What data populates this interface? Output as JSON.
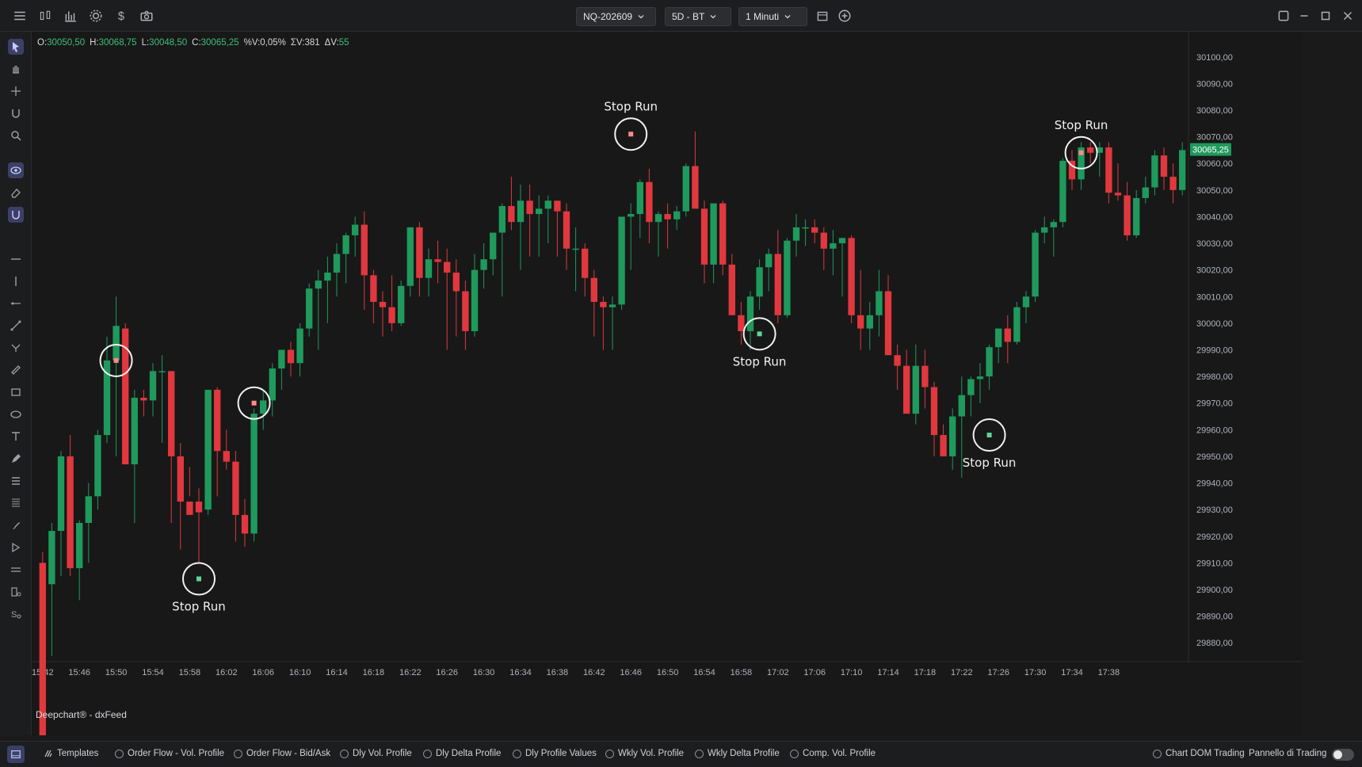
{
  "toolbar": {
    "symbol": "NQ-202609",
    "range": "5D - BT",
    "timeframe": "1 Minuti"
  },
  "ohlc": {
    "o_label": "O:",
    "o_value": "30050,50",
    "h_label": "H:",
    "h_value": "30068,75",
    "l_label": "L:",
    "l_value": "30048,50",
    "c_label": "C:",
    "c_value": "30065,25",
    "pct_label": "%V:",
    "pct_value": "0,05%",
    "sv_label": "ΣV:",
    "sv_value": "381",
    "dv_label": "ΔV:",
    "dv_value": "55"
  },
  "brand": "Deepchart® - dxFeed",
  "colors": {
    "up": "#1f9a5c",
    "down": "#e0383e",
    "background": "#181818",
    "price_tag": "#1f9a5c"
  },
  "chart_data": {
    "type": "candlestick",
    "last_price_label": "30065,25",
    "last_price": 30065.25,
    "ylim": [
      29875,
      30105
    ],
    "y_ticks": [
      "30100,00",
      "30090,00",
      "30080,00",
      "30070,00",
      "30060,00",
      "30050,00",
      "30040,00",
      "30030,00",
      "30020,00",
      "30010,00",
      "30000,00",
      "29990,00",
      "29980,00",
      "29970,00",
      "29960,00",
      "29950,00",
      "29940,00",
      "29930,00",
      "29920,00",
      "29910,00",
      "29900,00",
      "29890,00",
      "29880,00"
    ],
    "x_ticks": [
      "15:42",
      "15:46",
      "15:50",
      "15:54",
      "15:58",
      "16:02",
      "16:06",
      "16:10",
      "16:14",
      "16:18",
      "16:22",
      "16:26",
      "16:30",
      "16:34",
      "16:38",
      "16:42",
      "16:46",
      "16:50",
      "16:54",
      "16:58",
      "17:02",
      "17:06",
      "17:10",
      "17:14",
      "17:18",
      "17:22",
      "17:26",
      "17:30",
      "17:34",
      "17:38"
    ],
    "candles": [
      [
        29910,
        29914,
        29838,
        29842
      ],
      [
        29902,
        29925,
        29875,
        29922
      ],
      [
        29922,
        29952,
        29905,
        29950
      ],
      [
        29950,
        29958,
        29905,
        29908
      ],
      [
        29908,
        29926,
        29896,
        29925
      ],
      [
        29925,
        29940,
        29910,
        29935
      ],
      [
        29935,
        29960,
        29930,
        29958
      ],
      [
        29958,
        29995,
        29955,
        29986
      ],
      [
        29986,
        30010,
        29950,
        29999
      ],
      [
        29998,
        30000,
        29970,
        29947
      ],
      [
        29947,
        29975,
        29925,
        29972
      ],
      [
        29972,
        29975,
        29965,
        29971
      ],
      [
        29971,
        29985,
        29965,
        29982
      ],
      [
        29982,
        29988,
        29955,
        29982
      ],
      [
        29982,
        29982,
        29925,
        29950
      ],
      [
        29950,
        29955,
        29915,
        29933
      ],
      [
        29933,
        29946,
        29935,
        29928
      ],
      [
        29933,
        29938,
        29910,
        29929
      ],
      [
        29930,
        29975,
        29928,
        29975
      ],
      [
        29975,
        29976,
        29935,
        29952
      ],
      [
        29952,
        29960,
        29945,
        29948
      ],
      [
        29948,
        29952,
        29918,
        29928
      ],
      [
        29928,
        29934,
        29916,
        29921
      ],
      [
        29921,
        29968,
        29918,
        29966
      ],
      [
        29966,
        29975,
        29960,
        29971
      ],
      [
        29971,
        29985,
        29965,
        29983
      ],
      [
        29983,
        29990,
        29975,
        29990
      ],
      [
        29990,
        29993,
        29980,
        29985
      ],
      [
        29985,
        30000,
        29980,
        29998
      ],
      [
        29998,
        30015,
        29995,
        30013
      ],
      [
        30013,
        30020,
        29990,
        30016
      ],
      [
        30016,
        30025,
        30000,
        30019
      ],
      [
        30019,
        30030,
        30010,
        30026
      ],
      [
        30026,
        30034,
        30015,
        30033
      ],
      [
        30033,
        30040,
        30025,
        30037
      ],
      [
        30037,
        30042,
        30005,
        30018
      ],
      [
        30018,
        30020,
        30000,
        30008
      ],
      [
        30008,
        30012,
        29995,
        30006
      ],
      [
        30006,
        30018,
        29997,
        30000
      ],
      [
        30000,
        30016,
        29999,
        30014
      ],
      [
        30014,
        30036,
        30010,
        30036
      ],
      [
        30036,
        30038,
        30010,
        30017
      ],
      [
        30017,
        30028,
        30010,
        30024
      ],
      [
        30024,
        30031,
        30015,
        30023
      ],
      [
        30023,
        30028,
        29990,
        30019
      ],
      [
        30019,
        30024,
        29995,
        30012
      ],
      [
        30012,
        30016,
        29990,
        29997
      ],
      [
        29997,
        30026,
        29995,
        30020
      ],
      [
        30020,
        30030,
        30013,
        30024
      ],
      [
        30024,
        30032,
        30018,
        30034
      ],
      [
        30034,
        30045,
        30010,
        30044
      ],
      [
        30044,
        30055,
        30035,
        30038
      ],
      [
        30038,
        30052,
        30020,
        30046
      ],
      [
        30046,
        30052,
        30025,
        30041
      ],
      [
        30041,
        30048,
        30025,
        30043
      ],
      [
        30043,
        30048,
        30030,
        30046
      ],
      [
        30046,
        30046,
        30025,
        30042
      ],
      [
        30042,
        30045,
        30020,
        30028
      ],
      [
        30028,
        30036,
        30012,
        30028
      ],
      [
        30028,
        30030,
        30010,
        30017
      ],
      [
        30017,
        30020,
        29995,
        30008
      ],
      [
        30008,
        30010,
        29990,
        30006
      ],
      [
        30006,
        30010,
        29990,
        30007
      ],
      [
        30007,
        30040,
        30005,
        30040
      ],
      [
        30040,
        30045,
        30020,
        30041
      ],
      [
        30041,
        30054,
        30032,
        30053
      ],
      [
        30053,
        30058,
        30030,
        30038
      ],
      [
        30038,
        30042,
        30025,
        30041
      ],
      [
        30041,
        30045,
        30028,
        30039
      ],
      [
        30039,
        30044,
        30035,
        30042
      ],
      [
        30042,
        30060,
        30040,
        30059
      ],
      [
        30059,
        30072,
        30050,
        30043
      ],
      [
        30043,
        30046,
        30015,
        30022
      ],
      [
        30022,
        30045,
        30015,
        30045
      ],
      [
        30045,
        30046,
        30018,
        30022
      ],
      [
        30022,
        30026,
        30005,
        30003
      ],
      [
        30003,
        30008,
        29992,
        29997
      ],
      [
        29997,
        30012,
        29990,
        30010
      ],
      [
        30010,
        30024,
        30005,
        30021
      ],
      [
        30021,
        30028,
        30012,
        30026
      ],
      [
        30026,
        30035,
        30000,
        30003
      ],
      [
        30003,
        30032,
        30002,
        30031
      ],
      [
        30031,
        30041,
        30025,
        30036
      ],
      [
        30036,
        30039,
        30029,
        30036
      ],
      [
        30036,
        30039,
        30030,
        30034
      ],
      [
        30034,
        30036,
        30020,
        30028
      ],
      [
        30028,
        30035,
        30018,
        30030
      ],
      [
        30030,
        30032,
        30010,
        30032
      ],
      [
        30032,
        30033,
        30000,
        30003
      ],
      [
        30003,
        30020,
        29990,
        29998
      ],
      [
        29998,
        30008,
        29990,
        30003
      ],
      [
        30003,
        30020,
        29995,
        30012
      ],
      [
        30012,
        30018,
        29990,
        29988
      ],
      [
        29988,
        29992,
        29975,
        29984
      ],
      [
        29984,
        29990,
        29968,
        29966
      ],
      [
        29966,
        29992,
        29962,
        29984
      ],
      [
        29984,
        29990,
        29968,
        29976
      ],
      [
        29976,
        29978,
        29950,
        29958
      ],
      [
        29958,
        29962,
        29950,
        29950
      ],
      [
        29950,
        29968,
        29945,
        29965
      ],
      [
        29965,
        29980,
        29942,
        29973
      ],
      [
        29973,
        29980,
        29965,
        29979
      ],
      [
        29979,
        29985,
        29970,
        29980
      ],
      [
        29980,
        29992,
        29975,
        29991
      ],
      [
        29991,
        29998,
        29985,
        29998
      ],
      [
        29998,
        30003,
        29985,
        29993
      ],
      [
        29993,
        30008,
        29992,
        30006
      ],
      [
        30006,
        30012,
        30000,
        30010
      ],
      [
        30010,
        30035,
        30008,
        30034
      ],
      [
        30034,
        30040,
        30030,
        30036
      ],
      [
        30036,
        30039,
        30025,
        30038
      ],
      [
        30038,
        30062,
        30036,
        30061
      ],
      [
        30061,
        30065,
        30050,
        30054
      ],
      [
        30054,
        30068,
        30050,
        30066
      ],
      [
        30066,
        30068,
        30060,
        30064
      ],
      [
        30064,
        30068,
        30055,
        30066
      ],
      [
        30066,
        30068,
        30045,
        30049
      ],
      [
        30049,
        30060,
        30046,
        30048
      ],
      [
        30048,
        30053,
        30031,
        30033
      ],
      [
        30033,
        30050,
        30032,
        30047
      ],
      [
        30047,
        30055,
        30045,
        30051
      ],
      [
        30051,
        30065,
        30048,
        30063
      ],
      [
        30063,
        30066,
        30050,
        30055
      ],
      [
        30055,
        30060,
        30045,
        30050
      ],
      [
        30050,
        30068,
        30048,
        30065
      ]
    ],
    "annotations": [
      {
        "label": "Stop Run",
        "candle": 8,
        "price": 29986,
        "label_position": "none",
        "dot": "red"
      },
      {
        "label": "Stop Run",
        "candle": 17,
        "price": 29904,
        "label_position": "below",
        "dot": "green"
      },
      {
        "label": "Stop Run",
        "candle": 23,
        "price": 29970,
        "label_position": "none",
        "dot": "red"
      },
      {
        "label": "Stop Run",
        "candle": 64,
        "price": 30071,
        "label_position": "above",
        "dot": "red"
      },
      {
        "label": "Stop Run",
        "candle": 78,
        "price": 29996,
        "label_position": "below",
        "dot": "green"
      },
      {
        "label": "Stop Run",
        "candle": 103,
        "price": 29958,
        "label_position": "below",
        "dot": "green"
      },
      {
        "label": "Stop Run",
        "candle": 113,
        "price": 30064,
        "label_position": "above",
        "dot": "red"
      }
    ]
  },
  "bottom_bar": {
    "templates": "Templates",
    "items": [
      "Order Flow - Vol. Profile",
      "Order Flow - Bid/Ask",
      "Dly Vol. Profile",
      "Dly Delta Profile",
      "Dly Profile Values",
      "Wkly Vol. Profile",
      "Wkly Delta Profile",
      "Comp. Vol. Profile"
    ],
    "chart_dom": "Chart DOM Trading",
    "trading_panel": "Pannello di Trading"
  }
}
